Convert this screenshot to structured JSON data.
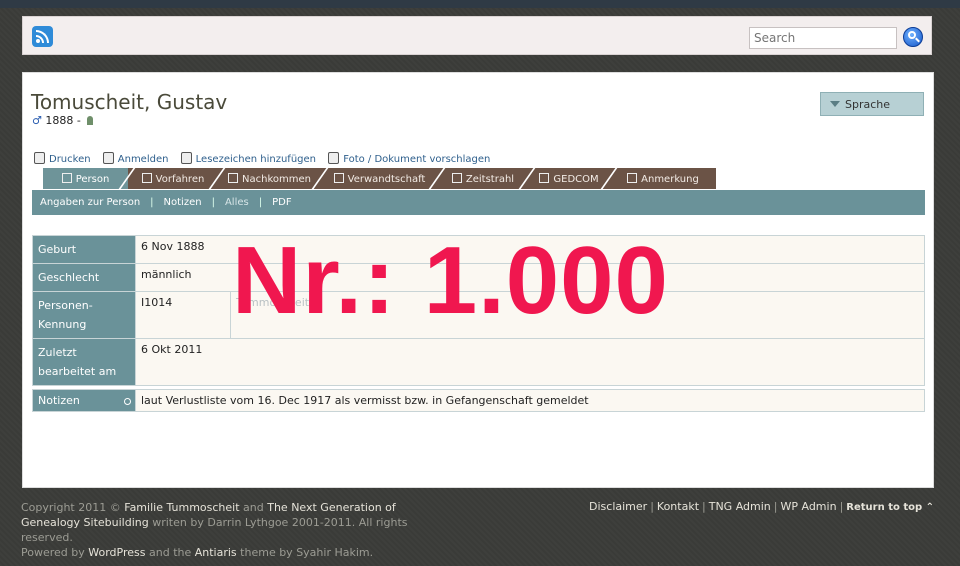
{
  "header": {
    "search_placeholder": "Search"
  },
  "person": {
    "name": "Tomuscheit, Gustav",
    "sex_symbol": "♂",
    "birth_range": "1888 -"
  },
  "language_button": "Sprache",
  "actions": [
    {
      "label": "Drucken",
      "icon": "print-icon"
    },
    {
      "label": "Anmelden",
      "icon": "lock-icon"
    },
    {
      "label": "Lesezeichen hinzufügen",
      "icon": "bookmark-icon"
    },
    {
      "label": "Foto / Dokument vorschlagen",
      "icon": "photo-icon"
    }
  ],
  "tabs": [
    {
      "label": "Person",
      "icon": "person-icon",
      "active": true
    },
    {
      "label": "Vorfahren",
      "icon": "ancestors-icon"
    },
    {
      "label": "Nachkommen",
      "icon": "descendants-icon"
    },
    {
      "label": "Verwandtschaft",
      "icon": "relationship-icon"
    },
    {
      "label": "Zeitstrahl",
      "icon": "timeline-icon"
    },
    {
      "label": "GEDCOM",
      "icon": "gedcom-icon"
    },
    {
      "label": "Anmerkung",
      "icon": "note-icon"
    }
  ],
  "subnav": {
    "items": [
      "Angaben zur Person",
      "Notizen",
      "Alles",
      "PDF"
    ]
  },
  "facts": [
    {
      "label": "Geburt",
      "value": "6 Nov 1888"
    },
    {
      "label": "Geschlecht",
      "value": "männlich"
    },
    {
      "label": "Personen-Kennung",
      "value": "I1014",
      "extra": "Tummoscheit"
    },
    {
      "label": "Zuletzt bearbeitet am",
      "value": "6 Okt 2011"
    }
  ],
  "notes": {
    "label": "Notizen",
    "text": "laut Verlustliste vom 16. Dec 1917 als vermisst bzw. in Gefangenschaft gemeldet"
  },
  "stamp_text": "Nr.:  1.000",
  "footer": {
    "copyright_prefix": "Copyright 2011 ©",
    "site_link": "Familie Tummoscheit",
    "and1": "and",
    "tng_link": "The Next Generation of Genealogy Sitebuilding",
    "tng_by": "writen by Darrin Lythgoe 2001-2011. All rights reserved.",
    "powered_prefix": "Powered by",
    "wp_link": "WordPress",
    "theme_mid": "and the",
    "theme_link": "Antiaris",
    "theme_by": "theme by Syahir Hakim.",
    "links": [
      "Disclaimer",
      "Kontakt",
      "TNG Admin",
      "WP Admin"
    ],
    "return_top": "Return to top ⌃"
  },
  "colors": {
    "teal": "#6a9299",
    "brown_tab": "#6b5346",
    "stamp": "#f0174f"
  }
}
